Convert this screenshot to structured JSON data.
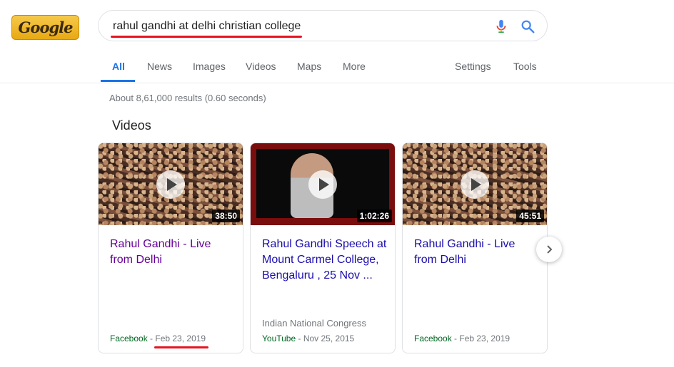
{
  "logo": {
    "text": "Google",
    "icon": "doodle-logo"
  },
  "search": {
    "query": "rahul gandhi at delhi christian college",
    "mic_icon": "mic-icon",
    "search_icon": "search-icon"
  },
  "tabs": {
    "items": [
      {
        "label": "All",
        "active": true
      },
      {
        "label": "News"
      },
      {
        "label": "Images"
      },
      {
        "label": "Videos"
      },
      {
        "label": "Maps"
      },
      {
        "label": "More"
      }
    ],
    "settings": "Settings",
    "tools": "Tools"
  },
  "results": {
    "stats": "About 8,61,000 results (0.60 seconds)"
  },
  "videos": {
    "heading": "Videos",
    "cards": [
      {
        "title": "Rahul Gandhi - Live from Delhi",
        "duration": "38:50",
        "channel": "",
        "source": "Facebook",
        "date": "Feb 23, 2019",
        "visited": true
      },
      {
        "title": "Rahul Gandhi Speech at Mount Carmel College, Bengaluru , 25 Nov ...",
        "duration": "1:02:26",
        "channel": "Indian National Congress",
        "source": "YouTube",
        "date": "Nov 25, 2015",
        "visited": false
      },
      {
        "title": "Rahul Gandhi - Live from Delhi",
        "duration": "45:51",
        "channel": "",
        "source": "Facebook",
        "date": "Feb 23, 2019",
        "visited": false
      }
    ],
    "next_icon": "chevron-right-icon"
  },
  "colors": {
    "link": "#1a0dab",
    "visited": "#660099",
    "source_green": "#006621",
    "annotation_red": "#e4151f",
    "tab_active": "#1a73e8"
  }
}
